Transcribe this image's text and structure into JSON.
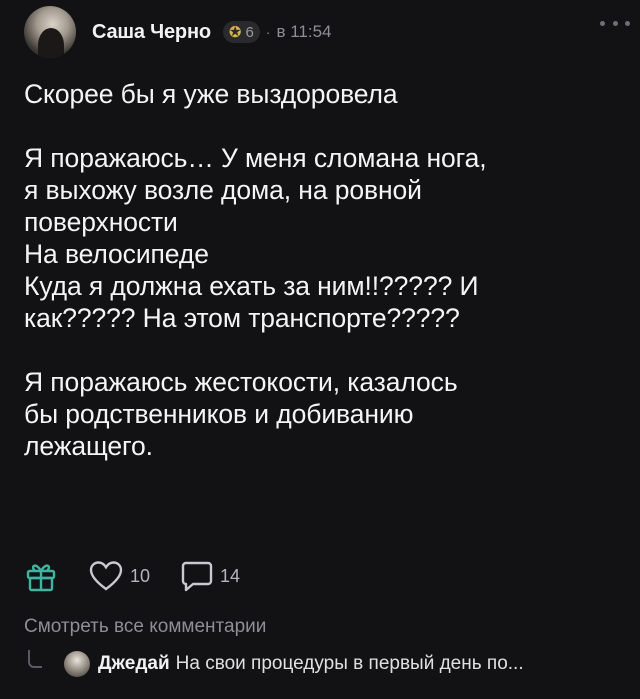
{
  "post": {
    "author": "Саша Черно",
    "badge_level": "6",
    "dot": "·",
    "time": "в 11:54",
    "lines": [
      "Скорее бы я уже выздоровела",
      "",
      "Я поражаюсь… У меня сломана нога,",
      "я выхожу возле дома, на ровной",
      "поверхности",
      "На велосипеде",
      "Куда я должна ехать за ним!!????? И",
      "как????? На этом транспорте?????",
      "",
      "Я поражаюсь жестокости, казалось",
      "бы родственников и добиванию",
      "лежащего."
    ]
  },
  "actions": {
    "gift_icon": "gift-icon",
    "like_icon": "heart-icon",
    "likes": "10",
    "comment_icon": "comment-bubble-icon",
    "comments": "14"
  },
  "comments": {
    "view_all": "Смотреть все комментарии",
    "preview": {
      "author": "Джедай",
      "text": "На свои процедуры в первый день по..."
    }
  },
  "colors": {
    "background": "#121214",
    "text": "#f4f4f4",
    "muted": "#8e8e93",
    "accent_gift": "#3fb4a0",
    "badge_icon": "#d6b14a"
  }
}
